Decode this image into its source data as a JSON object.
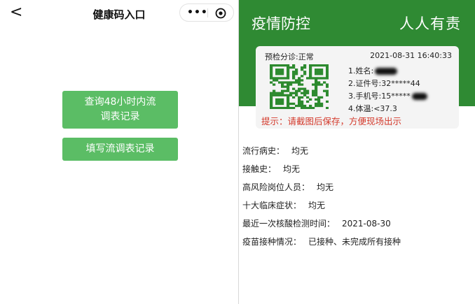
{
  "left": {
    "nav": {
      "back_glyph": "<",
      "title": "健康码入口",
      "more_glyph": "•••"
    },
    "buttons": {
      "query_label": "查询48小时内流调表记录",
      "fill_label": "填写流调表记录"
    }
  },
  "right": {
    "header": {
      "left_text": "疫情防控",
      "right_text": "人人有责"
    },
    "card": {
      "triage": "预检分诊:正常",
      "timestamp": "2021-08-31 16:40:33",
      "name_label": "1.姓名:",
      "id_label": "2.证件号:32*****44",
      "phone_label": "3.手机号:15*****",
      "temp_label": "4.体温:<37.3",
      "tip": "提示：请截图后保存，方便现场出示"
    },
    "history": [
      {
        "label": "流行病史：",
        "value": "均无"
      },
      {
        "label": "接触史：",
        "value": "均无"
      },
      {
        "label": "高风险岗位人员：",
        "value": "均无"
      },
      {
        "label": "十大临床症状：",
        "value": "均无"
      },
      {
        "label": "最近一次核酸检测时间：",
        "value": "2021-08-30"
      },
      {
        "label": "疫苗接种情况：",
        "value": "已接种、未完成所有接种"
      }
    ]
  },
  "colors": {
    "header_green": "#2f8a33",
    "button_green": "#5bbd65",
    "tip_red": "#d43a2c",
    "qr_green": "#2c8a2e"
  }
}
